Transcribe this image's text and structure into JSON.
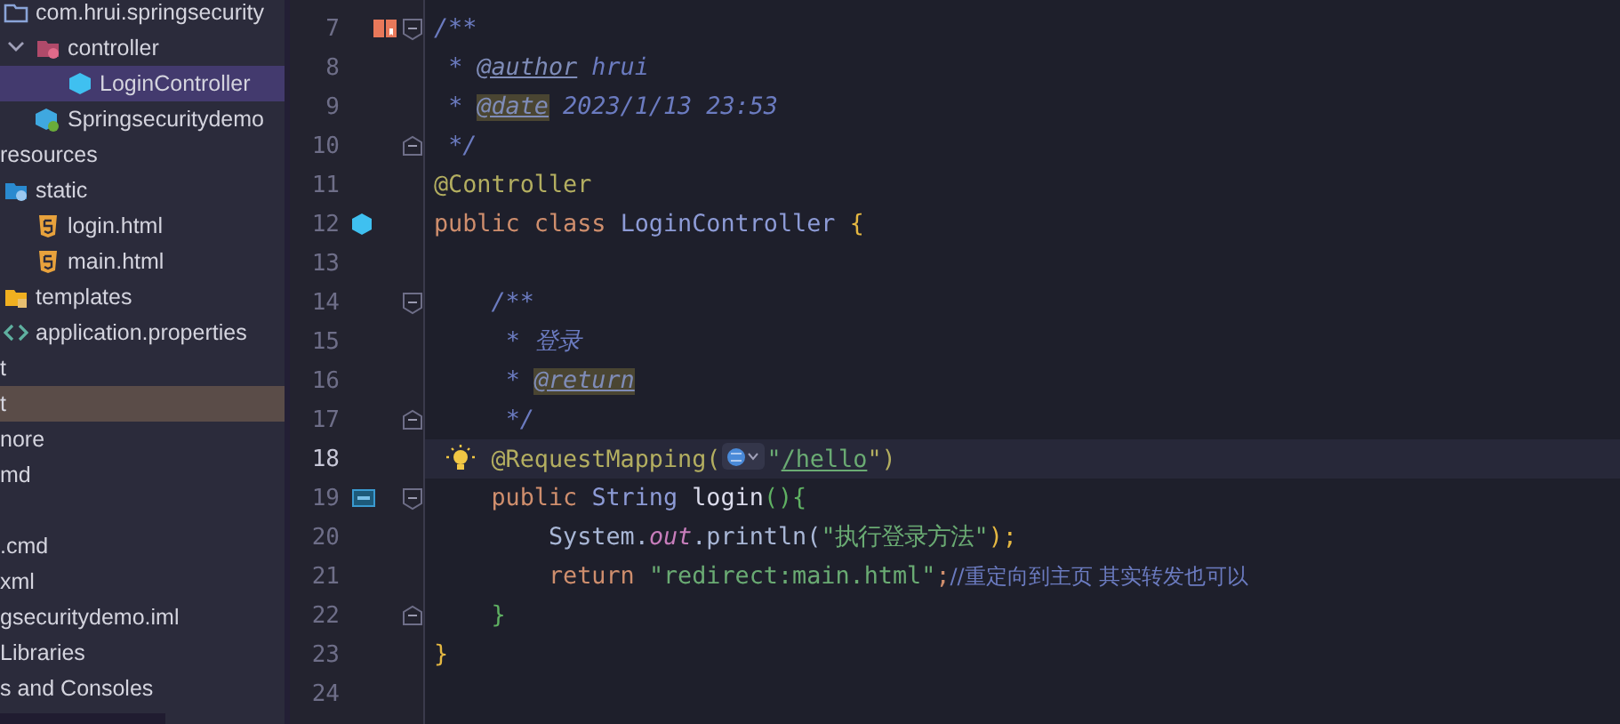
{
  "source_tree": [
    {
      "label": "com.hrui.springsecurity",
      "kind": "package",
      "selected": false,
      "highlighted": false,
      "children": [
        {
          "label": "controller",
          "kind": "package-gear",
          "selected": false,
          "highlighted": false,
          "children": [
            {
              "label": "LoginController",
              "kind": "class",
              "selected": true,
              "highlighted": false
            }
          ]
        },
        {
          "label": "Springsecuritydemo",
          "kind": "app-class",
          "selected": false,
          "highlighted": false
        }
      ]
    }
  ],
  "project_tree": [
    {
      "label": "resources",
      "kind": "plain",
      "selected": false,
      "highlighted": false,
      "children": [
        {
          "label": "static",
          "kind": "web-folder",
          "selected": false,
          "highlighted": false,
          "children": [
            {
              "label": "login.html",
              "kind": "html",
              "selected": false,
              "highlighted": false
            },
            {
              "label": "main.html",
              "kind": "html",
              "selected": false,
              "highlighted": false
            }
          ]
        },
        {
          "label": "templates",
          "kind": "template-folder",
          "selected": false,
          "highlighted": false
        },
        {
          "label": "application.properties",
          "kind": "properties",
          "selected": false,
          "highlighted": false
        }
      ]
    },
    {
      "label": "t",
      "kind": "plain",
      "selected": false,
      "highlighted": false
    },
    {
      "label": "t",
      "kind": "plain",
      "selected": false,
      "highlighted": true
    },
    {
      "label": "nore",
      "kind": "plain",
      "selected": false,
      "highlighted": false
    },
    {
      "label": "md",
      "kind": "plain",
      "selected": false,
      "highlighted": false
    },
    {
      "kind": "blank",
      "selected": false,
      "highlighted": false
    },
    {
      "label": ".cmd",
      "kind": "plain",
      "selected": false,
      "highlighted": false
    },
    {
      "label": "xml",
      "kind": "plain",
      "selected": false,
      "highlighted": false
    },
    {
      "label": "gsecuritydemo.iml",
      "kind": "plain",
      "selected": false,
      "highlighted": false
    },
    {
      "label": "Libraries",
      "kind": "plain",
      "selected": false,
      "highlighted": false
    },
    {
      "label": "s and Consoles",
      "kind": "plain",
      "selected": false,
      "highlighted": false
    }
  ],
  "editor": {
    "lines": [
      {
        "number": "7",
        "current": false,
        "gutter_icon": {
          "kind": "book"
        },
        "fold_start": true,
        "fold_end": false,
        "tokens": [
          {
            "text": "/**",
            "kind": "comment"
          }
        ]
      },
      {
        "number": "8",
        "current": false,
        "fold_start": false,
        "fold_end": false,
        "tokens": [
          {
            "text": " * ",
            "kind": "comment"
          },
          {
            "text": "@author",
            "kind": "doctag"
          },
          {
            "text": " hrui",
            "kind": "comment"
          }
        ]
      },
      {
        "number": "9",
        "current": false,
        "fold_start": false,
        "fold_end": false,
        "tokens": [
          {
            "text": " * ",
            "kind": "comment"
          },
          {
            "text": "@date",
            "kind": "marked"
          },
          {
            "text": " 2023/1/13 23:53",
            "kind": "comment"
          }
        ]
      },
      {
        "number": "10",
        "current": false,
        "fold_start": false,
        "fold_end": true,
        "tokens": [
          {
            "text": " */",
            "kind": "comment"
          }
        ]
      },
      {
        "number": "11",
        "current": false,
        "fold_start": false,
        "fold_end": false,
        "tokens": [
          {
            "text": "@Controller",
            "kind": "annotation"
          }
        ]
      },
      {
        "number": "12",
        "current": false,
        "gutter_icon": {
          "kind": "class"
        },
        "fold_start": false,
        "fold_end": false,
        "tokens": [
          {
            "text": "public class ",
            "kind": "keyword"
          },
          {
            "text": "LoginController ",
            "kind": "classname"
          },
          {
            "text": "{",
            "kind": "brace"
          }
        ]
      },
      {
        "number": "13",
        "current": false,
        "fold_start": false,
        "fold_end": false
      },
      {
        "number": "14",
        "current": false,
        "fold_start": true,
        "fold_end": false,
        "tokens": [
          {
            "text": "    /**",
            "kind": "comment"
          }
        ]
      },
      {
        "number": "15",
        "current": false,
        "fold_start": false,
        "fold_end": false,
        "tokens": [
          {
            "text": "     * 登录",
            "kind": "comment"
          }
        ]
      },
      {
        "number": "16",
        "current": false,
        "fold_start": false,
        "fold_end": false,
        "tokens": [
          {
            "text": "     * ",
            "kind": "comment"
          },
          {
            "text": "@return",
            "kind": "marked"
          }
        ]
      },
      {
        "number": "17",
        "current": false,
        "fold_start": false,
        "fold_end": true,
        "tokens": [
          {
            "text": "     */",
            "kind": "comment"
          }
        ]
      },
      {
        "number": "18",
        "current": true,
        "bulb": true,
        "fold_start": false,
        "fold_end": false,
        "tokens": [
          {
            "text": "    @RequestMapping(",
            "kind": "annotation"
          },
          {
            "kind": "inlay"
          },
          {
            "text": "\"",
            "kind": "string"
          },
          {
            "text": "/hello",
            "kind": "url"
          },
          {
            "text": "\")",
            "kind": "annotation"
          }
        ]
      },
      {
        "number": "19",
        "current": false,
        "gutter_icon": {
          "kind": "mapping"
        },
        "fold_start": true,
        "fold_end": false,
        "tokens": [
          {
            "text": "    public ",
            "kind": "keyword"
          },
          {
            "text": "String ",
            "kind": "classname"
          },
          {
            "text": "login",
            "kind": "method"
          },
          {
            "text": "(){",
            "kind": "green"
          }
        ]
      },
      {
        "number": "20",
        "current": false,
        "fold_start": false,
        "fold_end": false,
        "tokens": [
          {
            "text": "        System.",
            "kind": "plain"
          },
          {
            "text": "out",
            "kind": "field"
          },
          {
            "text": ".println(",
            "kind": "plain"
          },
          {
            "text": "\"执行登录方法\"",
            "kind": "string"
          },
          {
            "text": ");",
            "kind": "brace"
          }
        ]
      },
      {
        "number": "21",
        "current": false,
        "fold_start": false,
        "fold_end": false,
        "tokens": [
          {
            "text": "        return ",
            "kind": "keyword"
          },
          {
            "text": "\"redirect:main.html\"",
            "kind": "string"
          },
          {
            "text": ";",
            "kind": "keyword"
          },
          {
            "text": "//重定向到主页 其实转发也可以",
            "kind": "line-comment"
          }
        ]
      },
      {
        "number": "22",
        "current": false,
        "fold_start": false,
        "fold_end": true,
        "tokens": [
          {
            "text": "    }",
            "kind": "green"
          }
        ]
      },
      {
        "number": "23",
        "current": false,
        "fold_start": false,
        "fold_end": false,
        "tokens": [
          {
            "text": "}",
            "kind": "brace"
          }
        ]
      },
      {
        "number": "24",
        "current": false,
        "fold_start": false,
        "fold_end": false
      }
    ]
  }
}
